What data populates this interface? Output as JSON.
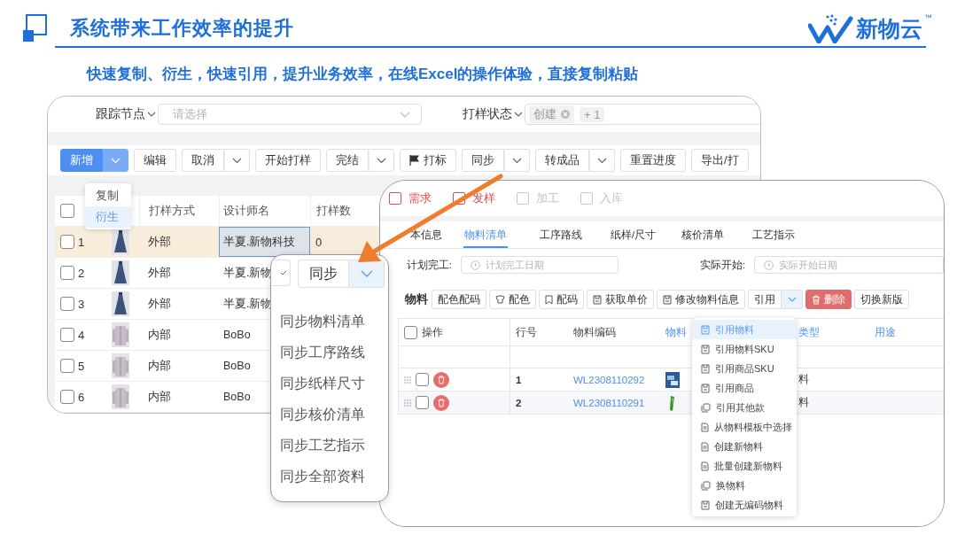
{
  "header": {
    "title": "系统带来工作效率的提升",
    "brand": "新物云",
    "trademark": "™"
  },
  "subtitle": "快速复制、衍生，快速引用，提升业务效率，在线Excel的操作体验，直接复制粘贴",
  "sample_window": {
    "filters": [
      {
        "label": "跟踪节点",
        "placeholder": "请选择"
      },
      {
        "label": "打样状态",
        "tags": [
          "创建"
        ],
        "more": "+ 1"
      }
    ],
    "toolbar": [
      {
        "label": "新增",
        "kind": "split",
        "primary": true
      },
      {
        "label": "编辑",
        "kind": "plain",
        "primary": false
      },
      {
        "label": "取消",
        "kind": "split",
        "primary": false
      },
      {
        "label": "开始打样",
        "kind": "plain",
        "primary": false
      },
      {
        "label": "完结",
        "kind": "split",
        "primary": false
      },
      {
        "label": "打标",
        "kind": "flag",
        "primary": false
      },
      {
        "label": "同步",
        "kind": "split",
        "primary": false
      },
      {
        "label": "转成品",
        "kind": "split",
        "primary": false
      },
      {
        "label": "重置进度",
        "kind": "plain",
        "primary": false
      },
      {
        "label": "导出/打",
        "kind": "plain",
        "primary": false
      }
    ],
    "all_checked": false,
    "add_menu": [
      {
        "label": "复制",
        "selected": false
      },
      {
        "label": "衍生",
        "selected": true
      }
    ],
    "columns": [
      "打样方式",
      "设计师名",
      "打样数"
    ],
    "rows": [
      {
        "no": "1",
        "checked": false,
        "highlighted": true,
        "method": "外部",
        "designer": "半夏.新物科技",
        "designer_focused": true,
        "count": "0"
      },
      {
        "no": "2",
        "checked": false,
        "highlighted": false,
        "method": "外部",
        "designer": "半夏.新物",
        "designer_focused": false
      },
      {
        "no": "3",
        "checked": false,
        "highlighted": false,
        "method": "外部",
        "designer": "半夏.新物",
        "designer_focused": false
      },
      {
        "no": "4",
        "checked": false,
        "highlighted": false,
        "method": "内部",
        "designer": "BoBo",
        "designer_focused": false
      },
      {
        "no": "5",
        "checked": false,
        "highlighted": false,
        "method": "内部",
        "designer": "BoBo",
        "designer_focused": false
      },
      {
        "no": "6",
        "checked": false,
        "highlighted": false,
        "method": "内部",
        "designer": "BoBo",
        "designer_focused": false
      }
    ]
  },
  "sync_popover": {
    "button": "同步",
    "items": [
      "同步物料清单",
      "同步工序路线",
      "同步纸样尺寸",
      "同步核价清单",
      "同步工艺指示",
      "同步全部资料"
    ]
  },
  "material_window": {
    "stages": [
      {
        "label": "需求",
        "color": "#e5484d"
      },
      {
        "label": "发样",
        "color": "#e5484d"
      },
      {
        "label": "加工",
        "color": "#c0c4cc"
      },
      {
        "label": "入库",
        "color": "#c0c4cc"
      }
    ],
    "tabs": [
      {
        "label": "本信息",
        "selected": false
      },
      {
        "label": "物料清单",
        "selected": true
      },
      {
        "label": "工序路线",
        "selected": false
      },
      {
        "label": "纸样/尺寸",
        "selected": false
      },
      {
        "label": "核价清单",
        "selected": false
      },
      {
        "label": "工艺指示",
        "selected": false
      }
    ],
    "dates": [
      {
        "label": "计划完工:",
        "placeholder": "计划完工日期"
      },
      {
        "label": "实际开始:",
        "placeholder": "实际开始日期"
      }
    ],
    "section": "物料",
    "toolbar": [
      {
        "label": "配色配码",
        "kind": "plain"
      },
      {
        "label": "配色",
        "kind": "palette"
      },
      {
        "label": "配码",
        "kind": "bookmark"
      },
      {
        "label": "获取单价",
        "kind": "save"
      },
      {
        "label": "修改物料信息",
        "kind": "save"
      },
      {
        "label": "引用",
        "kind": "split"
      },
      {
        "label": "删除",
        "kind": "danger"
      },
      {
        "label": "切换新版",
        "kind": "plain"
      }
    ],
    "all_checked": false,
    "columns": [
      {
        "label": "操作",
        "accent": false
      },
      {
        "label": "行号",
        "accent": false
      },
      {
        "label": "物料编码",
        "accent": false
      },
      {
        "label": "物料",
        "accent": true
      },
      {
        "label": "类型",
        "accent": true
      },
      {
        "label": "用途",
        "accent": true
      }
    ],
    "rows": [
      {
        "no": "1",
        "checked": false,
        "code": "WL2308110292",
        "type": "料"
      },
      {
        "no": "2",
        "checked": false,
        "code": "WL2308110291",
        "type": "料"
      }
    ],
    "ref_menu": [
      {
        "label": "引用物料",
        "selected": true
      },
      {
        "label": "引用物料SKU",
        "selected": false
      },
      {
        "label": "引用商品SKU",
        "selected": false
      },
      {
        "label": "引用商品",
        "selected": false
      },
      {
        "label": "引用其他款",
        "selected": false
      },
      {
        "label": "从物料模板中选择",
        "selected": false
      },
      {
        "label": "创建新物料",
        "selected": false
      },
      {
        "label": "批量创建新物料",
        "selected": false
      },
      {
        "label": "换物料",
        "selected": false
      },
      {
        "label": "创建无编码物料",
        "selected": false
      }
    ]
  }
}
